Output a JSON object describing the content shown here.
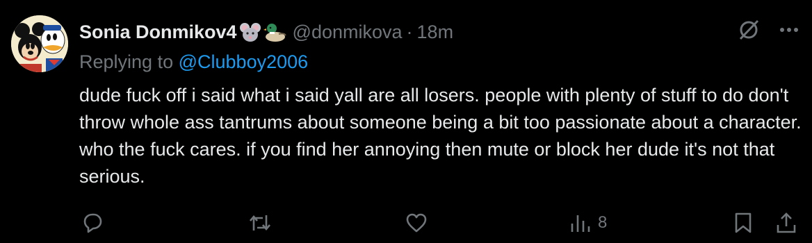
{
  "author": {
    "display_name": "Sonia Donmikov4",
    "handle": "@donmikova",
    "separator": "·",
    "time": "18m"
  },
  "reply": {
    "prefix": "Replying to",
    "mention": "@Clubboy2006"
  },
  "tweet": {
    "text": "dude fuck off i said what i said yall are all losers. people with plenty of stuff to do don't throw whole ass tantrums about someone being a bit too passionate about a character. who the fuck cares. if you find her annoying then mute or block her dude it's not that serious."
  },
  "actions": {
    "reply_icon": "reply-icon",
    "retweet_icon": "retweet-icon",
    "like_icon": "heart-icon",
    "views_icon": "bar-chart-icon",
    "views_count": "8",
    "bookmark_icon": "bookmark-icon",
    "share_icon": "share-icon"
  },
  "colors": {
    "background": "#000000",
    "text": "#e7e9ea",
    "muted": "#71767b",
    "link": "#1d9bf0"
  }
}
